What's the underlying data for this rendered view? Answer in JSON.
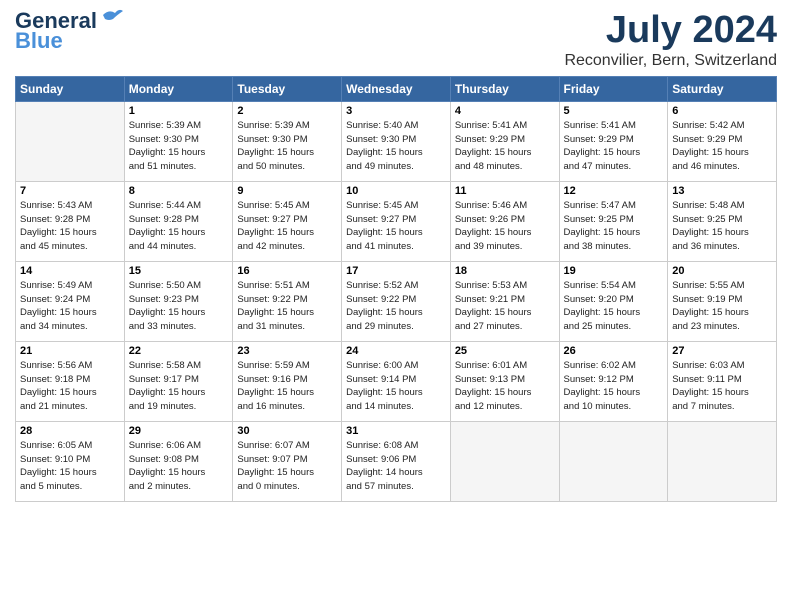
{
  "header": {
    "logo_general": "General",
    "logo_blue": "Blue",
    "month": "July 2024",
    "location": "Reconvilier, Bern, Switzerland"
  },
  "columns": [
    "Sunday",
    "Monday",
    "Tuesday",
    "Wednesday",
    "Thursday",
    "Friday",
    "Saturday"
  ],
  "weeks": [
    [
      {
        "day": "",
        "info": ""
      },
      {
        "day": "1",
        "info": "Sunrise: 5:39 AM\nSunset: 9:30 PM\nDaylight: 15 hours\nand 51 minutes."
      },
      {
        "day": "2",
        "info": "Sunrise: 5:39 AM\nSunset: 9:30 PM\nDaylight: 15 hours\nand 50 minutes."
      },
      {
        "day": "3",
        "info": "Sunrise: 5:40 AM\nSunset: 9:30 PM\nDaylight: 15 hours\nand 49 minutes."
      },
      {
        "day": "4",
        "info": "Sunrise: 5:41 AM\nSunset: 9:29 PM\nDaylight: 15 hours\nand 48 minutes."
      },
      {
        "day": "5",
        "info": "Sunrise: 5:41 AM\nSunset: 9:29 PM\nDaylight: 15 hours\nand 47 minutes."
      },
      {
        "day": "6",
        "info": "Sunrise: 5:42 AM\nSunset: 9:29 PM\nDaylight: 15 hours\nand 46 minutes."
      }
    ],
    [
      {
        "day": "7",
        "info": "Sunrise: 5:43 AM\nSunset: 9:28 PM\nDaylight: 15 hours\nand 45 minutes."
      },
      {
        "day": "8",
        "info": "Sunrise: 5:44 AM\nSunset: 9:28 PM\nDaylight: 15 hours\nand 44 minutes."
      },
      {
        "day": "9",
        "info": "Sunrise: 5:45 AM\nSunset: 9:27 PM\nDaylight: 15 hours\nand 42 minutes."
      },
      {
        "day": "10",
        "info": "Sunrise: 5:45 AM\nSunset: 9:27 PM\nDaylight: 15 hours\nand 41 minutes."
      },
      {
        "day": "11",
        "info": "Sunrise: 5:46 AM\nSunset: 9:26 PM\nDaylight: 15 hours\nand 39 minutes."
      },
      {
        "day": "12",
        "info": "Sunrise: 5:47 AM\nSunset: 9:25 PM\nDaylight: 15 hours\nand 38 minutes."
      },
      {
        "day": "13",
        "info": "Sunrise: 5:48 AM\nSunset: 9:25 PM\nDaylight: 15 hours\nand 36 minutes."
      }
    ],
    [
      {
        "day": "14",
        "info": "Sunrise: 5:49 AM\nSunset: 9:24 PM\nDaylight: 15 hours\nand 34 minutes."
      },
      {
        "day": "15",
        "info": "Sunrise: 5:50 AM\nSunset: 9:23 PM\nDaylight: 15 hours\nand 33 minutes."
      },
      {
        "day": "16",
        "info": "Sunrise: 5:51 AM\nSunset: 9:22 PM\nDaylight: 15 hours\nand 31 minutes."
      },
      {
        "day": "17",
        "info": "Sunrise: 5:52 AM\nSunset: 9:22 PM\nDaylight: 15 hours\nand 29 minutes."
      },
      {
        "day": "18",
        "info": "Sunrise: 5:53 AM\nSunset: 9:21 PM\nDaylight: 15 hours\nand 27 minutes."
      },
      {
        "day": "19",
        "info": "Sunrise: 5:54 AM\nSunset: 9:20 PM\nDaylight: 15 hours\nand 25 minutes."
      },
      {
        "day": "20",
        "info": "Sunrise: 5:55 AM\nSunset: 9:19 PM\nDaylight: 15 hours\nand 23 minutes."
      }
    ],
    [
      {
        "day": "21",
        "info": "Sunrise: 5:56 AM\nSunset: 9:18 PM\nDaylight: 15 hours\nand 21 minutes."
      },
      {
        "day": "22",
        "info": "Sunrise: 5:58 AM\nSunset: 9:17 PM\nDaylight: 15 hours\nand 19 minutes."
      },
      {
        "day": "23",
        "info": "Sunrise: 5:59 AM\nSunset: 9:16 PM\nDaylight: 15 hours\nand 16 minutes."
      },
      {
        "day": "24",
        "info": "Sunrise: 6:00 AM\nSunset: 9:14 PM\nDaylight: 15 hours\nand 14 minutes."
      },
      {
        "day": "25",
        "info": "Sunrise: 6:01 AM\nSunset: 9:13 PM\nDaylight: 15 hours\nand 12 minutes."
      },
      {
        "day": "26",
        "info": "Sunrise: 6:02 AM\nSunset: 9:12 PM\nDaylight: 15 hours\nand 10 minutes."
      },
      {
        "day": "27",
        "info": "Sunrise: 6:03 AM\nSunset: 9:11 PM\nDaylight: 15 hours\nand 7 minutes."
      }
    ],
    [
      {
        "day": "28",
        "info": "Sunrise: 6:05 AM\nSunset: 9:10 PM\nDaylight: 15 hours\nand 5 minutes."
      },
      {
        "day": "29",
        "info": "Sunrise: 6:06 AM\nSunset: 9:08 PM\nDaylight: 15 hours\nand 2 minutes."
      },
      {
        "day": "30",
        "info": "Sunrise: 6:07 AM\nSunset: 9:07 PM\nDaylight: 15 hours\nand 0 minutes."
      },
      {
        "day": "31",
        "info": "Sunrise: 6:08 AM\nSunset: 9:06 PM\nDaylight: 14 hours\nand 57 minutes."
      },
      {
        "day": "",
        "info": ""
      },
      {
        "day": "",
        "info": ""
      },
      {
        "day": "",
        "info": ""
      }
    ]
  ]
}
